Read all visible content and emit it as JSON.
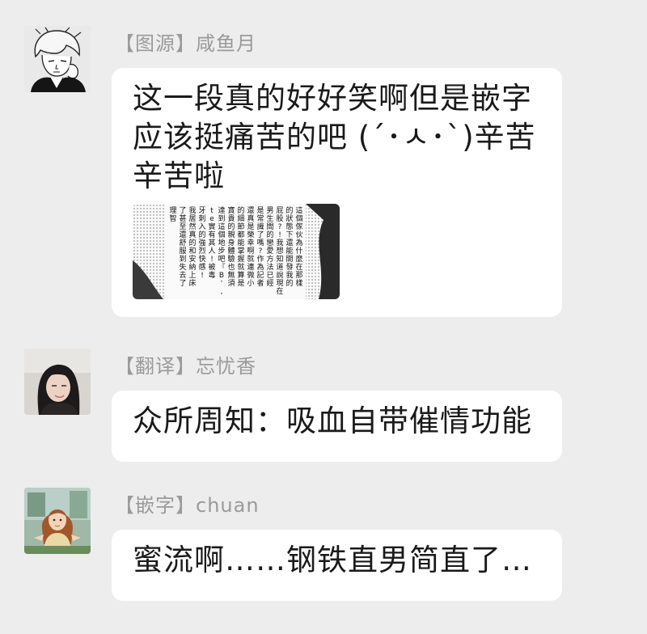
{
  "messages": [
    {
      "sender": "【图源】咸鱼月",
      "text": "这一段真的好好笑啊但是嵌字应该挺痛苦的吧 (´･ㅅ･`)辛苦辛苦啦",
      "attachment": {
        "type": "image",
        "columns": [
          "這個傢伙為什麼在那樣",
          "的狀態下還能開發我的",
          "屁股?!我想知道說現在",
          "男生間的戀愛方法已經",
          "是常識了嗎?作為記者",
          "還真是榮幸啊就連微小",
          "的細節都能掌握就算是",
          "寶貴的親身體驗也無須",
          "達到這個地步吧『B',",
          "te實有其人!被毒",
          "牙刺入的強烈快感!",
          "我居然真的和安納上床",
          "了甚至還舒服到失去了",
          "理智"
        ]
      }
    },
    {
      "sender": "【翻译】忘忧香",
      "text": "众所周知：吸血自带催情功能"
    },
    {
      "sender": "【嵌字】chuan",
      "text": "蜜流啊……钢铁直男简直了…"
    }
  ]
}
